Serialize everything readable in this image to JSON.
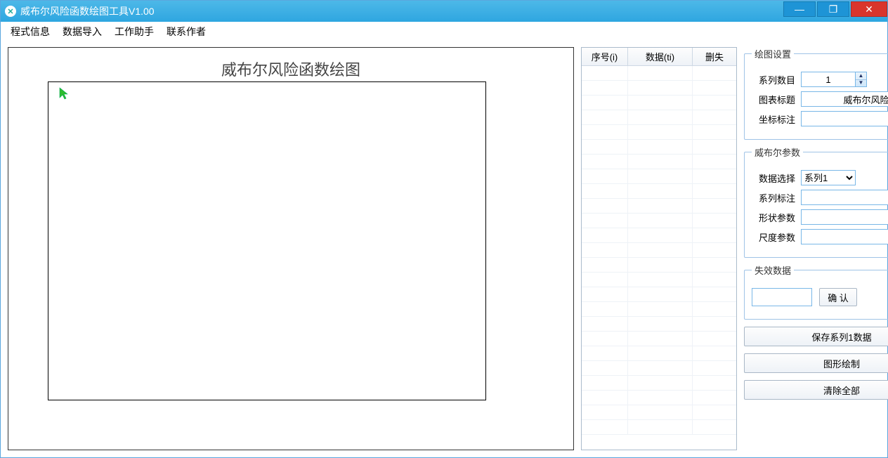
{
  "window": {
    "title": "威布尔风险函数绘图工具V1.00"
  },
  "menu": {
    "program_info": "程式信息",
    "data_import": "数据导入",
    "work_assistant": "工作助手",
    "contact_author": "联系作者"
  },
  "chart": {
    "title": "威布尔风险函数绘图"
  },
  "chart_data": {
    "type": "line",
    "title": "威布尔风险函数绘图",
    "series": [],
    "x": [],
    "xlabel": "",
    "ylabel": ""
  },
  "grid": {
    "columns": {
      "index": "序号(i)",
      "data": "数据(ti)",
      "delete": "删失"
    },
    "rows": []
  },
  "plot_settings": {
    "legend": "绘图设置",
    "series_count_label": "系列数目",
    "series_count_value": "1",
    "chart_title_label": "图表标题",
    "chart_title_value": "威布尔风险",
    "axis_label_label": "坐标标注",
    "axis_label_value": ""
  },
  "weibull_params": {
    "legend": "威布尔参数",
    "data_select_label": "数据选择",
    "data_select_value": "系列1",
    "series_label_label": "系列标注",
    "series_label_value": "",
    "shape_label": "形状参数",
    "shape_value": "",
    "scale_label": "尺度参数",
    "scale_value": ""
  },
  "failure_data": {
    "legend": "失效数据",
    "value": "",
    "confirm_label": "确 认"
  },
  "buttons": {
    "save_series": "保存系列1数据",
    "draw": "图形绘制",
    "clear_all": "清除全部"
  }
}
